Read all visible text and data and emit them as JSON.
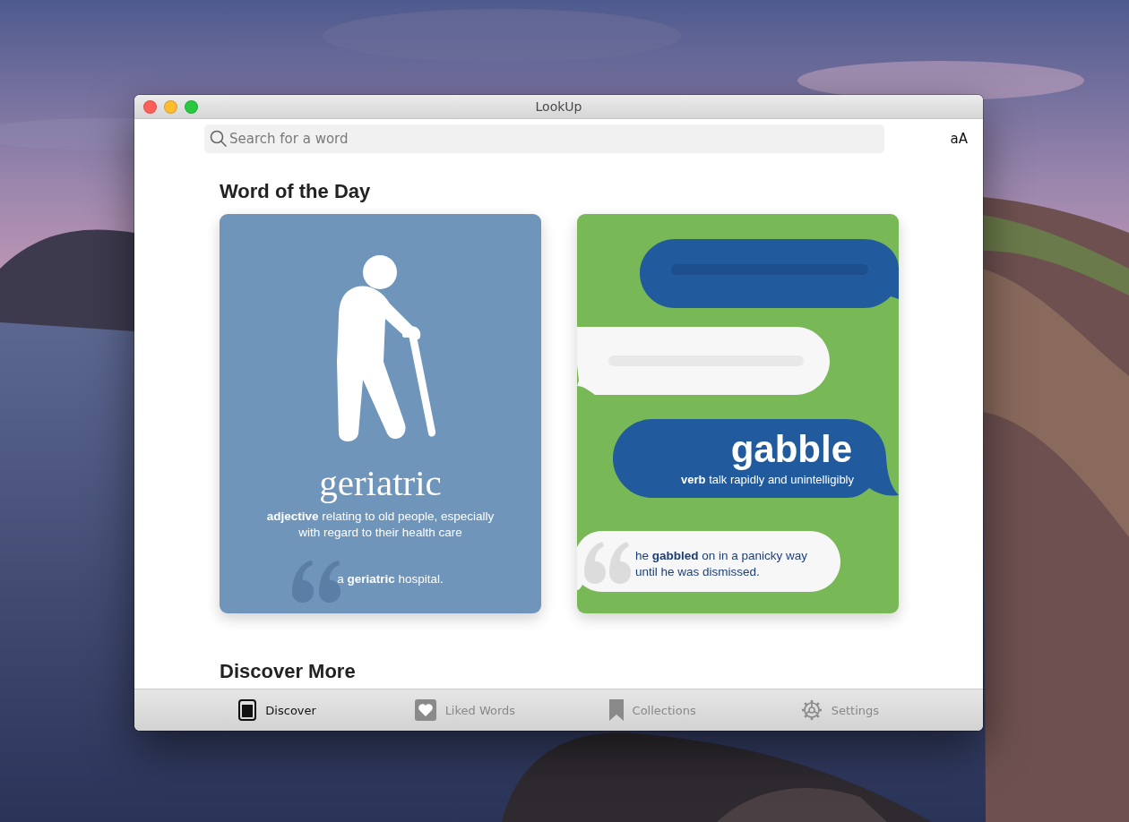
{
  "window": {
    "title": "LookUp"
  },
  "search": {
    "placeholder": "Search for a word"
  },
  "text_size_button": "aA",
  "word_of_the_day": {
    "title": "Word of the Day",
    "cards": [
      {
        "kind": "illustrated",
        "word": "geriatric",
        "definition": "**adjective** relating to old people, especially with regard to their health care",
        "example": "a **geriatric** hospital."
      },
      {
        "kind": "chat",
        "word": "gabble",
        "definition": "**verb** talk rapidly and unintelligibly",
        "example": "he **gabbled** on in a panicky way until he was dismissed."
      }
    ]
  },
  "discover_more": {
    "title": "Discover More"
  },
  "tabs": [
    {
      "label": "Discover",
      "selected": true
    },
    {
      "label": "Liked Words",
      "selected": false
    },
    {
      "label": "Collections",
      "selected": false
    },
    {
      "label": "Settings",
      "selected": false
    }
  ]
}
